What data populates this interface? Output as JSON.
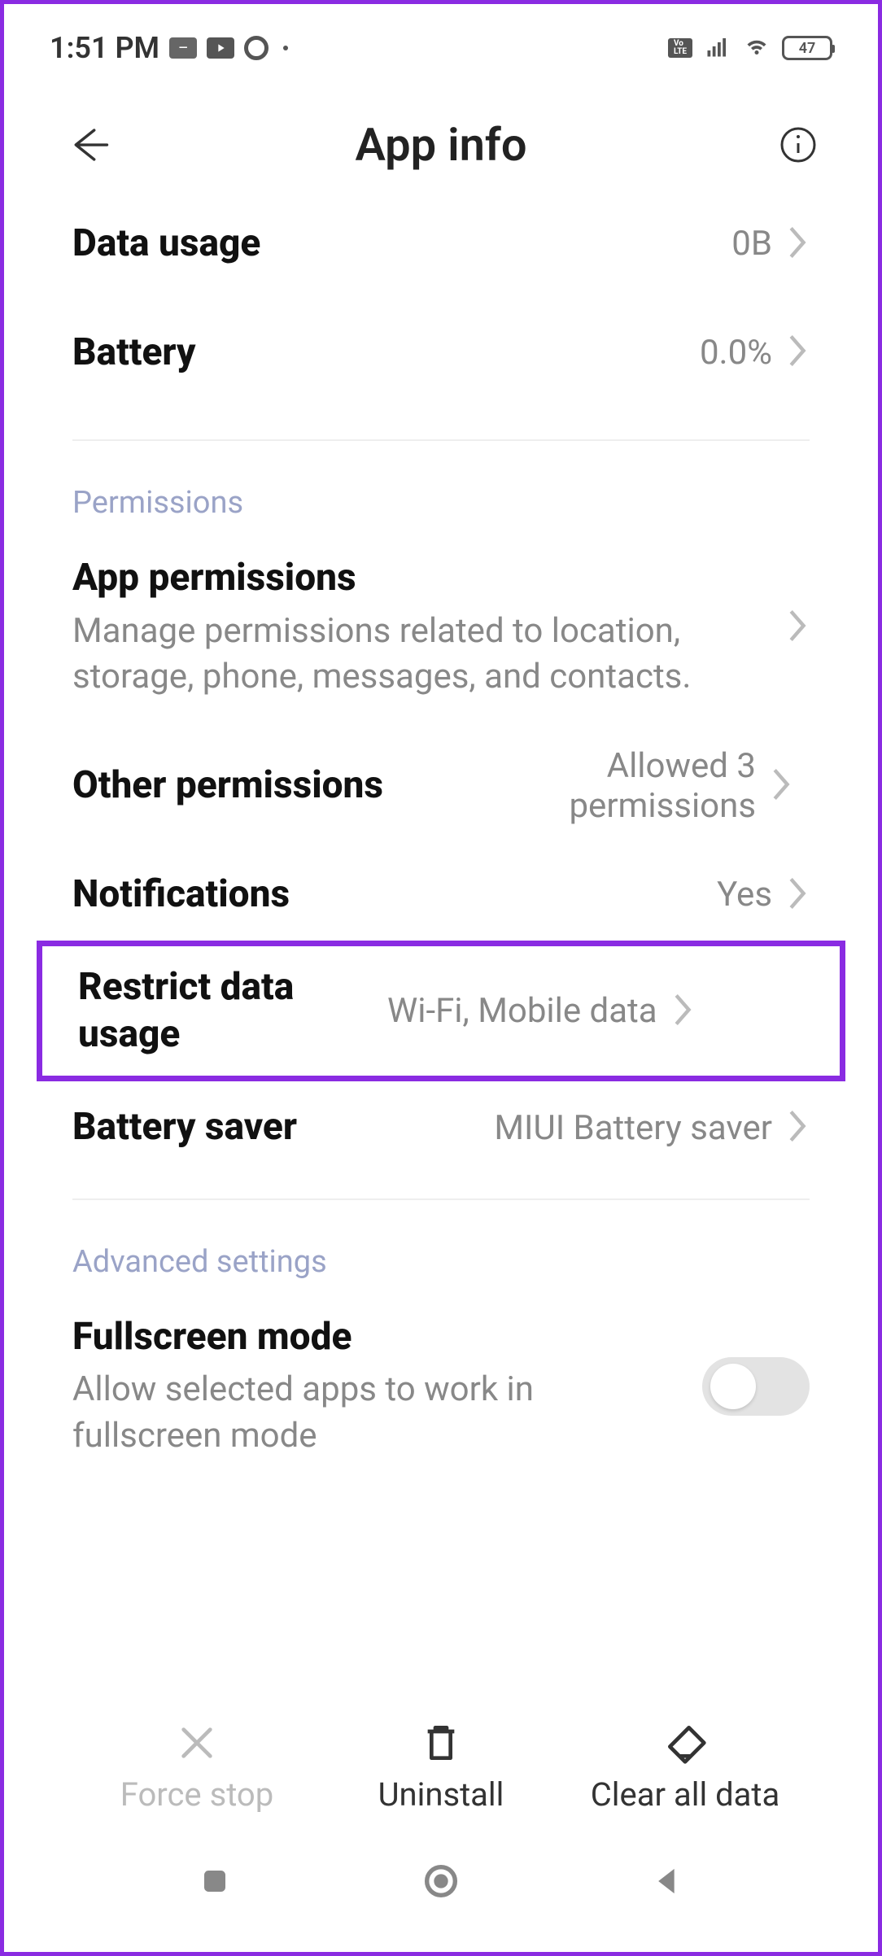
{
  "status": {
    "time": "1:51 PM",
    "battery_text": "47"
  },
  "header": {
    "title": "App info"
  },
  "rows": {
    "data_usage": {
      "title": "Data usage",
      "value": "0B"
    },
    "battery": {
      "title": "Battery",
      "value": "0.0%"
    },
    "app_permissions": {
      "title": "App permissions",
      "sub": "Manage permissions related to location, storage, phone, messages, and contacts."
    },
    "other_permissions": {
      "title": "Other permissions",
      "value": "Allowed 3 permissions"
    },
    "notifications": {
      "title": "Notifications",
      "value": "Yes"
    },
    "restrict_data": {
      "title": "Restrict data usage",
      "value": "Wi-Fi, Mobile data"
    },
    "battery_saver": {
      "title": "Battery saver",
      "value": "MIUI Battery saver"
    },
    "fullscreen": {
      "title": "Fullscreen mode",
      "sub": "Allow selected apps to work in fullscreen mode"
    }
  },
  "sections": {
    "permissions": "Permissions",
    "advanced": "Advanced settings"
  },
  "actions": {
    "force_stop": "Force stop",
    "uninstall": "Uninstall",
    "clear_data": "Clear all data"
  }
}
